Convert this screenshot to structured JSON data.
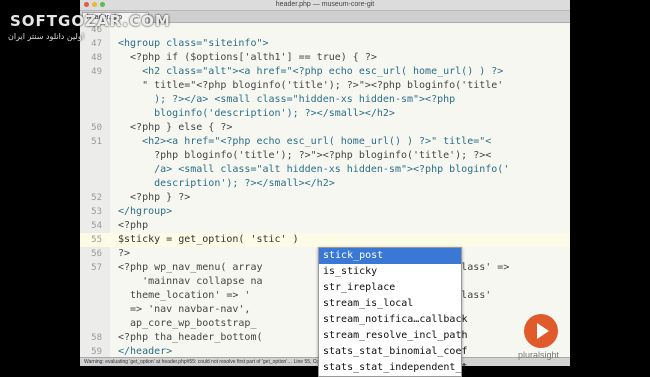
{
  "window": {
    "title": "header.php — museum-core-git",
    "tab_label": "header.php",
    "tab_close": "×"
  },
  "lines": [
    {
      "num": "46",
      "text": ""
    },
    {
      "num": "47",
      "text": "<hgroup class=\"siteinfo\">"
    },
    {
      "num": "48",
      "text": "  <?php if ($options['alth1'] == true) { ?>"
    },
    {
      "num": "49",
      "text": "    <h2 class=\"alt\"><a href=\"<?php echo esc_url( home_url() ) ?>"
    },
    {
      "num": "",
      "text": "    \" title=\"<?php bloginfo('title'); ?>\"><?php bloginfo('title'"
    },
    {
      "num": "",
      "text": "      ); ?></a> <small class=\"hidden-xs hidden-sm\"><?php"
    },
    {
      "num": "",
      "text": "      bloginfo('description'); ?></small></h2>"
    },
    {
      "num": "50",
      "text": "  <?php } else { ?>"
    },
    {
      "num": "51",
      "text": "    <h2><a href=\"<?php echo esc_url( home_url() ) ?>\" title=\"<"
    },
    {
      "num": "",
      "text": "      ?php bloginfo('title'); ?>\"><?php bloginfo('title'); ?><"
    },
    {
      "num": "",
      "text": "      /a> <small class=\"alt hidden-xs hidden-sm\"><?php bloginfo('"
    },
    {
      "num": "",
      "text": "      description'); ?></small></h2>"
    },
    {
      "num": "52",
      "text": "  <?php } ?>"
    },
    {
      "num": "53",
      "text": "</hgroup>"
    },
    {
      "num": "54",
      "text": "<?php"
    },
    {
      "num": "55",
      "text": "$sticky = get_option( 'stic' )"
    },
    {
      "num": "56",
      "text": "?>"
    },
    {
      "num": "57",
      "text": "<?php wp_nav_menu( array                      container_class' =>"
    },
    {
      "num": "",
      "text": "    'mainnav collapse na                      ollapse', '"
    },
    {
      "num": "",
      "text": "  theme_location' => '                      alse, 'menu_class'"
    },
    {
      "num": "",
      "text": "  => 'nav navbar-nav',"
    },
    {
      "num": "",
      "text": "  ap_core_wp_bootstrap_"
    },
    {
      "num": "58",
      "text": "<?php tha_header_bottom("
    },
    {
      "num": "59",
      "text": "</header>"
    }
  ],
  "autocomplete": {
    "items": [
      "stick_post",
      "is_sticky",
      "str_ireplace",
      "stream_is_local",
      "stream_notifica…callback",
      "stream_resolve_incl_path",
      "stats_stat_binomial_coef",
      "stats_stat_independent_t"
    ],
    "selected_index": 0
  },
  "status_text": "Warning: evaluating 'get_option' at header.php#55: could not resolve first part of 'get_option'… Line 55, Column 29 — 65 Lines",
  "watermark": {
    "line1": "SOFTGOZAR.COM",
    "line2": "اولین دانلود سنتر ایران"
  },
  "brand": "pluralsight",
  "colors": {
    "selection": "#3a78d6",
    "play_button": "#e05a2b",
    "editor_bg": "#f7f7f2"
  }
}
